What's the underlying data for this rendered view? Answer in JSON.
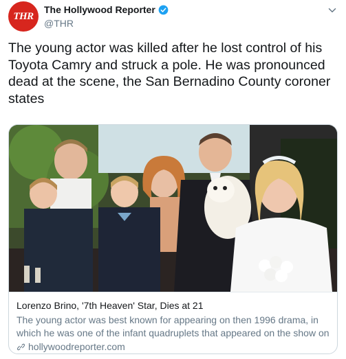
{
  "account": {
    "display_name": "The Hollywood Reporter",
    "handle": "@THR",
    "avatar_text": "THR",
    "avatar_color": "#d7261e",
    "verified": true
  },
  "tweet": {
    "text": "The young actor was killed after he lost control of his Toyota Camry and struck a pole. He was pronounced dead at the scene, the San Bernadino County coroner states"
  },
  "card": {
    "image_icon": "photo-of-people-at-wedding",
    "title": "Lorenzo Brino, '7th Heaven' Star, Dies at 21",
    "description": "The young actor was best known for appearing on then 1996 drama, in which he was one of the infant quadruplets that appeared on the show on ...",
    "domain": "hollywoodreporter.com"
  },
  "colors": {
    "text_primary": "#14171a",
    "text_secondary": "#657786",
    "border": "#ccd6dd",
    "verified_blue": "#1da1f2"
  }
}
